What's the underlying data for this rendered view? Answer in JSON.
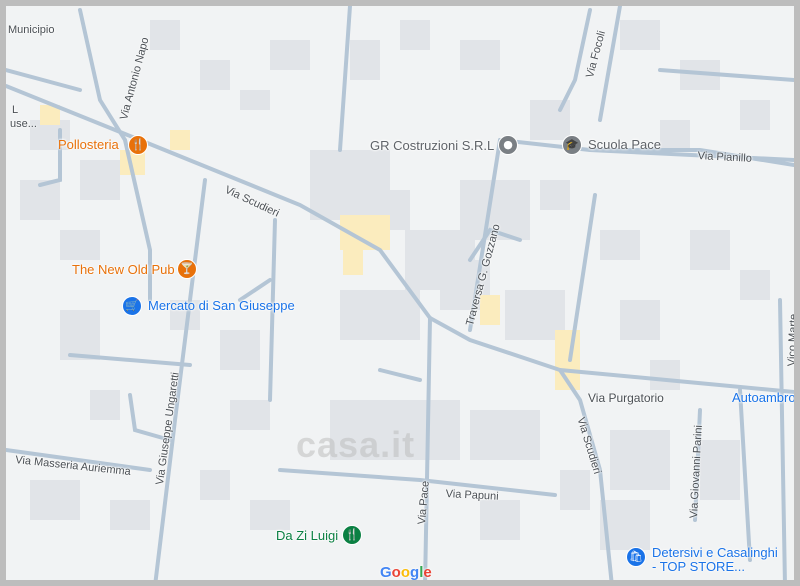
{
  "map": {
    "streets": {
      "municipio": "Municipio",
      "via_antonio_napo": "Via Antonio Napo",
      "via_scudieri_top": "Via Scudieri",
      "traversa_g_gozzano": "Traversa G. Gozzano",
      "via_focoli": "Via Focoli",
      "via_pianillo": "Via Pianillo",
      "via_purgatorio": "Via Purgatorio",
      "via_scudieri_right": "Via Scudieri",
      "via_giuseppe_ungaretti": "Via Giuseppe Ungaretti",
      "via_masseria_auriemma": "Via Masseria Auriemma",
      "via_pace": "Via Pace",
      "via_papuni": "Via Papuni",
      "via_giovanni_parini": "Via Giovanni Parini",
      "vico_marte": "Vico Marte",
      "cut_left_l": "L",
      "cut_left_use": "use..."
    },
    "pois": {
      "pollosteria": "Pollosteria",
      "new_old_pub": "The New Old Pub",
      "mercato": "Mercato di San Giuseppe",
      "gr_costruzioni": "GR Costruzioni S.R.L",
      "scuola_pace": "Scuola Pace",
      "da_zi_luigi": "Da Zi Luigi",
      "detersivi_line1": "Detersivi e Casalinghi",
      "detersivi_line2": "- TOP STORE...",
      "autoambro": "Autoambro"
    },
    "icons": {
      "restaurant": "restaurant-icon",
      "bar": "cocktail-bar-icon",
      "cart": "shopping-cart-icon",
      "business": "business-pin-icon",
      "school": "school-icon",
      "store": "store-bag-icon"
    },
    "colors": {
      "background": "#f1f3f4",
      "road": "#b4c5d5",
      "building": "#e1e4e8",
      "highlight": "#fbecbe",
      "poi_orange": "#e8710a",
      "poi_blue": "#1a73e8",
      "poi_green": "#0b8043"
    },
    "watermark": "casa.it",
    "google_logo": [
      "G",
      "o",
      "o",
      "g",
      "l",
      "e"
    ]
  }
}
